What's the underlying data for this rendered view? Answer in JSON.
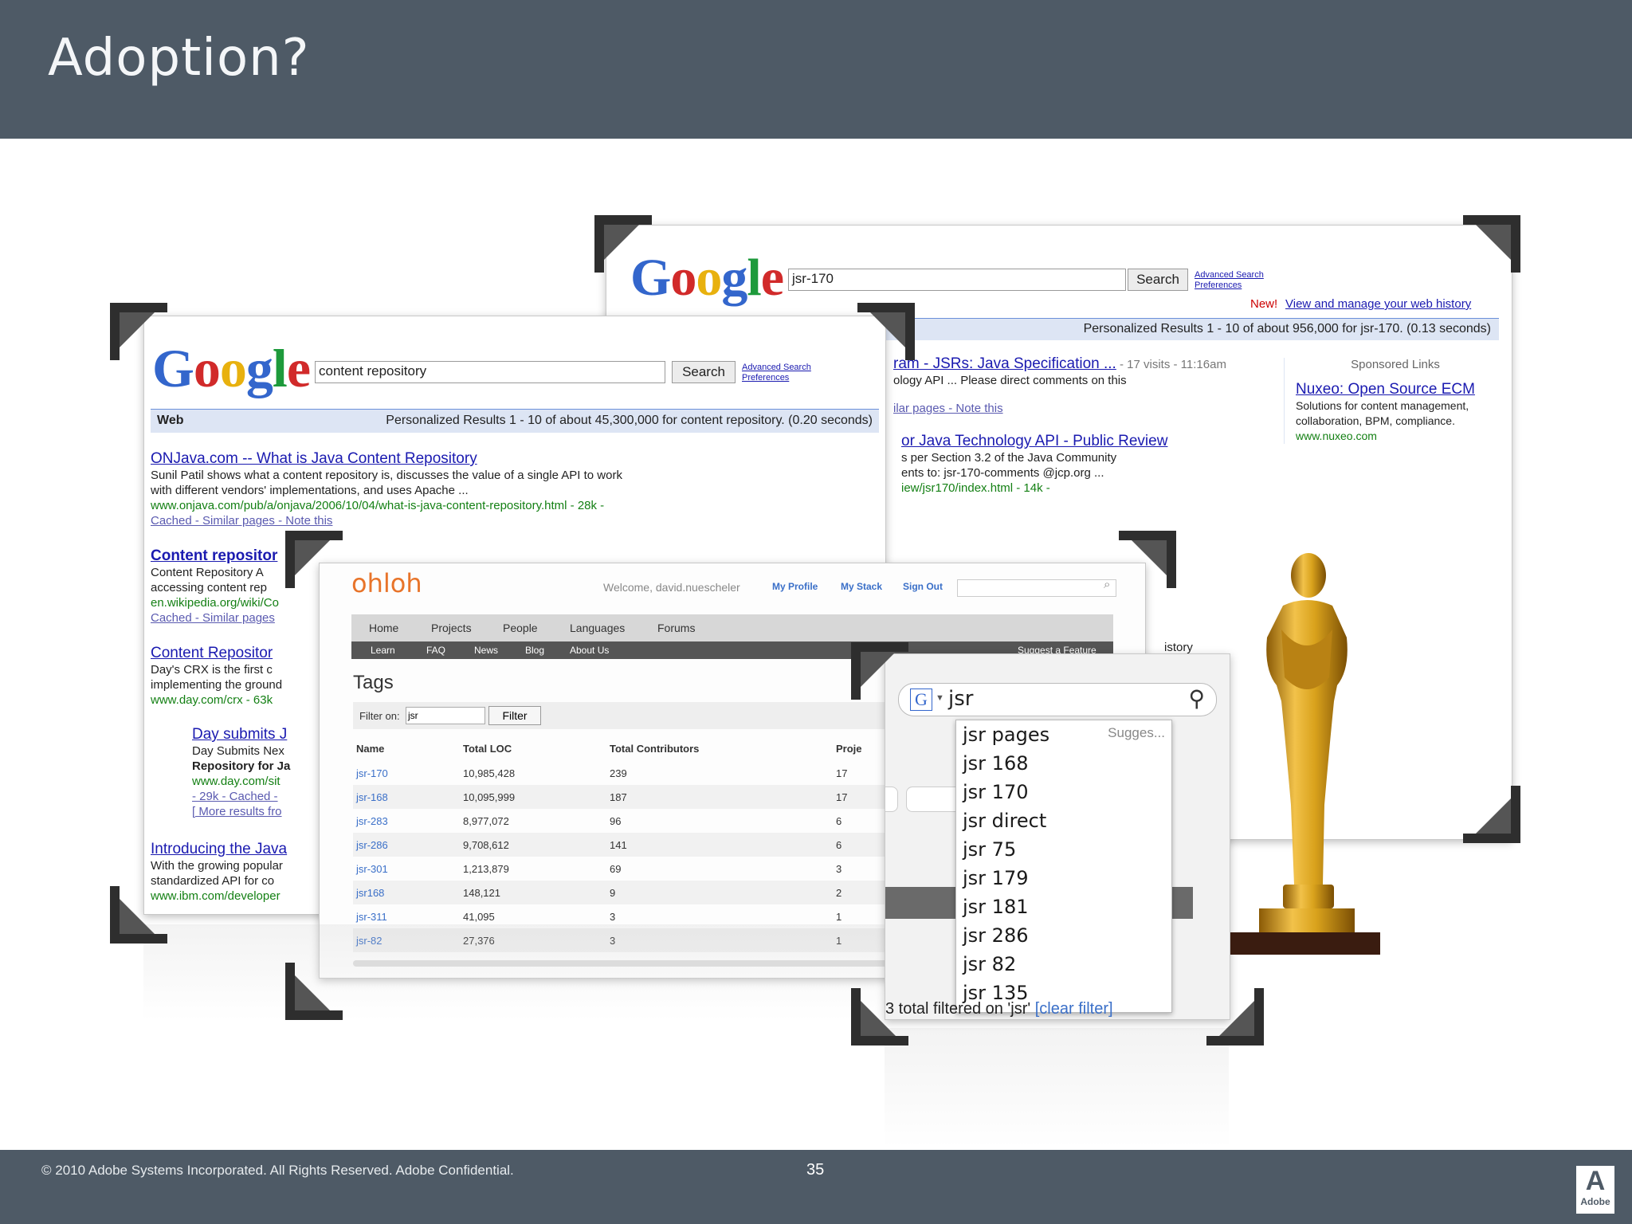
{
  "slide": {
    "title": "Adoption?",
    "copyright": "© 2010 Adobe Systems Incorporated.  All Rights Reserved.  Adobe Confidential.",
    "page_number": "35",
    "logo_text": "Adobe"
  },
  "google_back": {
    "query": "jsr-170",
    "search_label": "Search",
    "advanced_search": "Advanced Search",
    "preferences": "Preferences",
    "new_label": "New!",
    "history_link": "View and manage your web history",
    "results_bar": "Personalized Results 1 - 10 of about 956,000 for jsr-170. (0.13 seconds)",
    "results": [
      {
        "title": "ram - JSRs: Java Specification ...",
        "meta": " - 17 visits - 11:16am",
        "text": "ology API ... Please direct comments on this",
        "links": "ilar pages - Note this"
      },
      {
        "title": "or Java Technology API - Public Review",
        "text1": "s per Section 3.2 of the Java Community",
        "text2": "ents to: jsr-170-comments @jcp.org ...",
        "url": "iew/jsr170/index.html - 14k -"
      }
    ],
    "sponsored_label": "Sponsored Links",
    "ad_title": "Nuxeo: Open Source ECM",
    "ad_text1": "Solutions for content management,",
    "ad_text2": "collaboration, BPM, compliance.",
    "ad_url": "www.nuxeo.com",
    "history_tail": "istory"
  },
  "google_front": {
    "query": "content repository",
    "search_label": "Search",
    "advanced_search": "Advanced Search",
    "preferences": "Preferences",
    "web_label": "Web",
    "results_bar": "Personalized Results 1 - 10 of about 45,300,000 for content repository. (0.20 seconds)",
    "results": [
      {
        "title": "ONJava.com -- What is Java Content Repository",
        "line1": "Sunil Patil shows what a content repository is, discusses the value of a single API to work",
        "line2": "with different vendors' implementations, and uses Apache ...",
        "url": "www.onjava.com/pub/a/onjava/2006/10/04/what-is-java-content-repository.html - 28k -",
        "links": "Cached - Similar pages - Note this"
      },
      {
        "title": "Content repositor",
        "line1": "Content Repository A",
        "line2": "accessing content rep",
        "url": "en.wikipedia.org/wiki/Co",
        "links": "Cached - Similar pages"
      },
      {
        "title": "Content Repositor",
        "line1": "Day's CRX is the first c",
        "line2": "implementing the ground",
        "url": "www.day.com/crx - 63k"
      },
      {
        "title": "Day submits J",
        "line1": "Day Submits Nex",
        "line2": "Repository for Ja",
        "url": "www.day.com/sit",
        "links": "- 29k - Cached - ",
        "more": "[ More results fro"
      },
      {
        "title": "Introducing the Java",
        "line1": "With the growing popular",
        "line2": "standardized API for co",
        "url": "www.ibm.com/developer"
      }
    ]
  },
  "ohloh": {
    "logo": "ohloh",
    "welcome": "Welcome, david.nuescheler",
    "my_profile": "My Profile",
    "my_stack": "My Stack",
    "sign_out": "Sign Out",
    "nav": [
      "Home",
      "Projects",
      "People",
      "Languages",
      "Forums"
    ],
    "subnav": [
      "Learn",
      "FAQ",
      "News",
      "Blog",
      "About Us"
    ],
    "suggest": "Suggest a Feature",
    "heading": "Tags",
    "filter_label": "Filter on:",
    "filter_value": "jsr",
    "filter_button": "Filter",
    "columns": [
      "Name",
      "Total LOC",
      "Total Contributors",
      "Proje"
    ],
    "rows": [
      [
        "jsr-170",
        "10,985,428",
        "239",
        "17"
      ],
      [
        "jsr-168",
        "10,095,999",
        "187",
        "17"
      ],
      [
        "jsr-283",
        "8,977,072",
        "96",
        "6"
      ],
      [
        "jsr-286",
        "9,708,612",
        "141",
        "6"
      ],
      [
        "jsr-301",
        "1,213,879",
        "69",
        "3"
      ],
      [
        "jsr168",
        "148,121",
        "9",
        "2"
      ],
      [
        "jsr-311",
        "41,095",
        "3",
        "1"
      ],
      [
        "jsr-82",
        "27,376",
        "3",
        "1"
      ]
    ]
  },
  "suggest_popup": {
    "search_text": "jsr ",
    "suggestions_label": "Sugges...",
    "items": [
      "jsr pages",
      "jsr 168",
      "jsr 170",
      "jsr direct",
      "jsr 75",
      "jsr 179",
      "jsr 181",
      "jsr 286",
      "jsr 82",
      "jsr 135"
    ],
    "footer_text": "3 total filtered on 'jsr'",
    "clear_filter": "[clear filter]"
  },
  "colors": {
    "slide_bar": "#4e5a66",
    "google_blue": "#3366cc",
    "link": "#1a1ab0",
    "url_green": "#148014",
    "ohloh_orange": "#e8742a",
    "gold": "#d9a21c"
  }
}
